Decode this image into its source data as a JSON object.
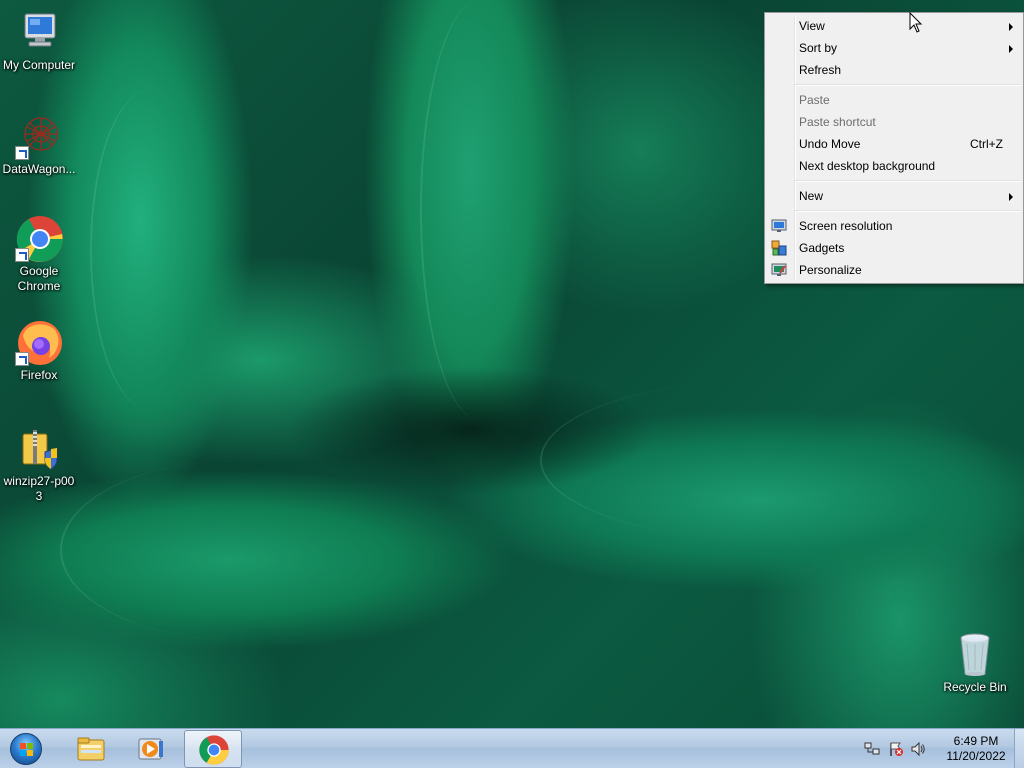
{
  "desktop": {
    "icons": [
      {
        "label": "My Computer",
        "icon": "computer-icon"
      },
      {
        "label": "DataWagon...",
        "icon": "datawagon-icon"
      },
      {
        "label": "Google Chrome",
        "icon": "chrome-icon"
      },
      {
        "label": "Firefox",
        "icon": "firefox-icon"
      },
      {
        "label": "winzip27-p003",
        "icon": "winzip-installer-icon"
      },
      {
        "label": "Recycle Bin",
        "icon": "recycle-bin-icon"
      }
    ]
  },
  "context_menu": {
    "view": "View",
    "sort_by": "Sort by",
    "refresh": "Refresh",
    "paste": "Paste",
    "paste_shortcut": "Paste shortcut",
    "undo_move": "Undo Move",
    "undo_move_shortcut": "Ctrl+Z",
    "next_background": "Next desktop background",
    "new": "New",
    "screen_resolution": "Screen resolution",
    "gadgets": "Gadgets",
    "personalize": "Personalize"
  },
  "taskbar": {
    "pinned": [
      "windows-explorer-icon",
      "media-player-icon",
      "chrome-icon"
    ],
    "clock_time": "6:49 PM",
    "clock_date": "11/20/2022"
  },
  "colors": {
    "menu_bg": "#f0f0f0",
    "taskbar_accent": "#b3c9e2",
    "wallpaper_green": "#148858"
  }
}
